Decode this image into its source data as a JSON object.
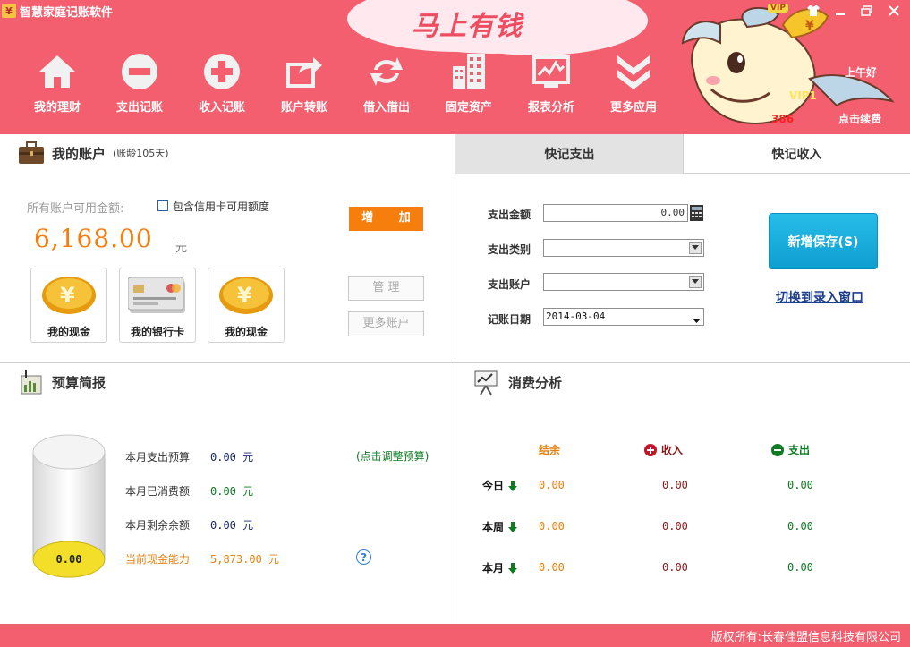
{
  "app": {
    "logo": "¥",
    "title": "智慧家庭记账软件",
    "slogan": "马上有钱",
    "vip_badge": "VIP"
  },
  "toolbar": [
    {
      "label": "我的理财",
      "icon": "home-icon"
    },
    {
      "label": "支出记账",
      "icon": "minus-circle-icon"
    },
    {
      "label": "收入记账",
      "icon": "plus-circle-icon"
    },
    {
      "label": "账户转账",
      "icon": "transfer-icon"
    },
    {
      "label": "借入借出",
      "icon": "refresh-icon"
    },
    {
      "label": "固定资产",
      "icon": "building-icon"
    },
    {
      "label": "报表分析",
      "icon": "chart-icon"
    },
    {
      "label": "更多应用",
      "icon": "double-chevron-down-icon"
    }
  ],
  "user": {
    "greeting": "上午好",
    "level_label": "",
    "level_value": "VIP1",
    "days_prefix": "",
    "days_value": "386",
    "renew_link": "点击续费"
  },
  "accounts": {
    "title": "我的账户",
    "age": "(账龄105天)",
    "available_label": "所有账户可用金额:",
    "include_credit_label": "包含信用卡可用额度",
    "total": "6,168.00",
    "unit": "元",
    "add_button": "增  加",
    "manage_button": "管  理",
    "more_button": "更多账户",
    "cards": [
      {
        "label": "我的现金",
        "icon": "coin-icon"
      },
      {
        "label": "我的银行卡",
        "icon": "bank-card-icon"
      },
      {
        "label": "我的现金",
        "icon": "coin-icon"
      }
    ]
  },
  "quick_entry": {
    "tab_expense": "快记支出",
    "tab_income": "快记收入",
    "amount_label": "支出金额",
    "amount_value": "0.00",
    "category_label": "支出类别",
    "category_value": "",
    "account_label": "支出账户",
    "account_value": "",
    "date_label": "记账日期",
    "date_value": "2014-03-04",
    "save_button": "新增保存(S)",
    "switch_link": "切换到录入窗口"
  },
  "budget": {
    "title": "预算简报",
    "rows": [
      {
        "label": "本月支出预算",
        "value": "0.00 元"
      },
      {
        "label": "本月已消费额",
        "value": "0.00 元"
      },
      {
        "label": "本月剩余余额",
        "value": "0.00 元"
      },
      {
        "label": "当前现金能力",
        "value": "5,873.00 元"
      }
    ],
    "adjust_link": "(点击调整预算)",
    "cylinder_value": "0.00",
    "help": "?"
  },
  "consumption": {
    "title": "消费分析",
    "columns": [
      "结余",
      "收入",
      "支出"
    ],
    "rows": [
      {
        "label": "今日",
        "balance": "0.00",
        "income": "0.00",
        "expense": "0.00"
      },
      {
        "label": "本周",
        "balance": "0.00",
        "income": "0.00",
        "expense": "0.00"
      },
      {
        "label": "本月",
        "balance": "0.00",
        "income": "0.00",
        "expense": "0.00"
      }
    ]
  },
  "footer": {
    "copyright": "版权所有:长春佳盟信息科技有限公司"
  },
  "colors": {
    "brand": "#f35f6e",
    "accent_orange": "#f57e0d",
    "save_blue": "#19aedc"
  }
}
